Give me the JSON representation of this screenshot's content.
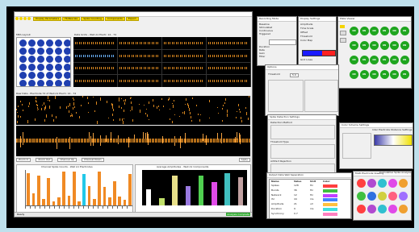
{
  "main_window": {
    "menu": [
      "Display Parameters",
      "Fit/Rescale",
      "Spike Counting",
      "Components",
      "Export"
    ],
    "left_title": "MEA Layout",
    "grid_title": "Data Grids - Well A1 Electr. 14 - 74",
    "wave_title": "Raw Data - Electrode 74 of Well A1 Electr. 14 - 74",
    "wave_controls": [
      "Zoom In",
      "Zoom Out",
      "Channel Up",
      "Channel Down",
      "Apply"
    ],
    "bottom_left_title": "Channel Spike Counts - Well A1 Electrodes",
    "bottom_right_title": "Average Amplitudes - Well A1 Components",
    "status_left": "Ready",
    "status_right": "Analysis Complete"
  },
  "chart_data": [
    {
      "type": "bar",
      "title": "",
      "xlabel": "",
      "ylabel": "",
      "categories": [
        "1",
        "2",
        "3",
        "4",
        "5",
        "6",
        "7",
        "8",
        "9",
        "10",
        "11",
        "12",
        "13",
        "14",
        "15",
        "16",
        "17",
        "18",
        "19",
        "20",
        "21"
      ],
      "values": [
        0.92,
        0.35,
        0.85,
        0.18,
        0.78,
        0.12,
        0.22,
        0.95,
        0.28,
        0.95,
        0.12,
        0.88,
        0.55,
        0.18,
        0.95,
        0.52,
        0.22,
        0.68,
        0.25,
        0.15,
        0.88
      ],
      "ylim": [
        0,
        1
      ],
      "colors": {
        "bar": "#f08a24",
        "highlight": "#22c8e8"
      },
      "highlight_index": 11
    },
    {
      "type": "bar",
      "title": "",
      "xlabel": "",
      "ylabel": "",
      "categories": [
        "A",
        "B",
        "C",
        "D",
        "E",
        "F",
        "G",
        "H"
      ],
      "values": [
        0.45,
        0.2,
        0.85,
        0.55,
        0.85,
        0.65,
        0.92,
        0.8
      ],
      "ylim": [
        0,
        1
      ],
      "colors": [
        "#ffffff",
        "#c0e06a",
        "#e8e08a",
        "#9a7ae0",
        "#50d050",
        "#e04be8",
        "#40c0c0",
        "#c0a0a0"
      ]
    }
  ],
  "recording_dialog": {
    "title": "Recording Mode",
    "options": [
      "Baseline",
      "Stimulated",
      "Continuous",
      "Triggered"
    ],
    "fields": [
      "Duration",
      "Rate",
      "Gain",
      "Filter"
    ]
  },
  "display_settings_dialog": {
    "title": "Display Settings",
    "items": [
      "Amplitude",
      "Time Scale",
      "Offset",
      "Threshold",
      "Color Map",
      "Grid Lines"
    ],
    "colormap_colors": [
      "#1a1aff",
      "#ff2020"
    ]
  },
  "plate_window": {
    "title": "Plate Viewer",
    "well_label": "ON",
    "rows": 4,
    "cols": 6
  },
  "small_dialog": {
    "title": "Options",
    "label": "Threshold",
    "value": "5.0"
  },
  "spike_dialog": {
    "title": "Spike Detection Settings",
    "sections": [
      "Detection Method",
      "Threshold Type",
      "Artifact Rejection",
      "Output"
    ],
    "buttons": [
      "OK",
      "Cancel"
    ]
  },
  "color_scheme_window": {
    "title": "Color Scheme Settings",
    "subtitle": "Inter Electrode Distance Settings",
    "gradient": [
      "#3a3aa8",
      "#ffffff",
      "#f0e000"
    ]
  },
  "table_window": {
    "title": "Output Data Well Separation",
    "headers": [
      "Name",
      "Value",
      "Unit",
      "Color"
    ],
    "rows": [
      [
        "Spikes",
        "128",
        "Hz",
        "#ff4040"
      ],
      [
        "Bursts",
        "36",
        "Hz",
        "#40c040"
      ],
      [
        "Network",
        "12",
        "Hz",
        "#c040ff"
      ],
      [
        "ISI",
        "44",
        "ms",
        "#4080ff"
      ],
      [
        "Amplitude",
        "21",
        "uV",
        "#ffc040"
      ],
      [
        "Duration",
        "9",
        "ms",
        "#40e0e0"
      ],
      [
        "Synchrony",
        "0.7",
        "",
        "#ff80c0"
      ]
    ]
  },
  "component_window": {
    "title": "Multi Electrode Viewing",
    "subtitle": "Cumulative Spike Analysis",
    "colors": [
      "#ff4040",
      "#b04ad0",
      "#30c0d0",
      "#e04ae8",
      "#f0a030",
      "#40c040",
      "#3070e0",
      "#d0d040",
      "#ff6080",
      "#a070ff"
    ]
  }
}
